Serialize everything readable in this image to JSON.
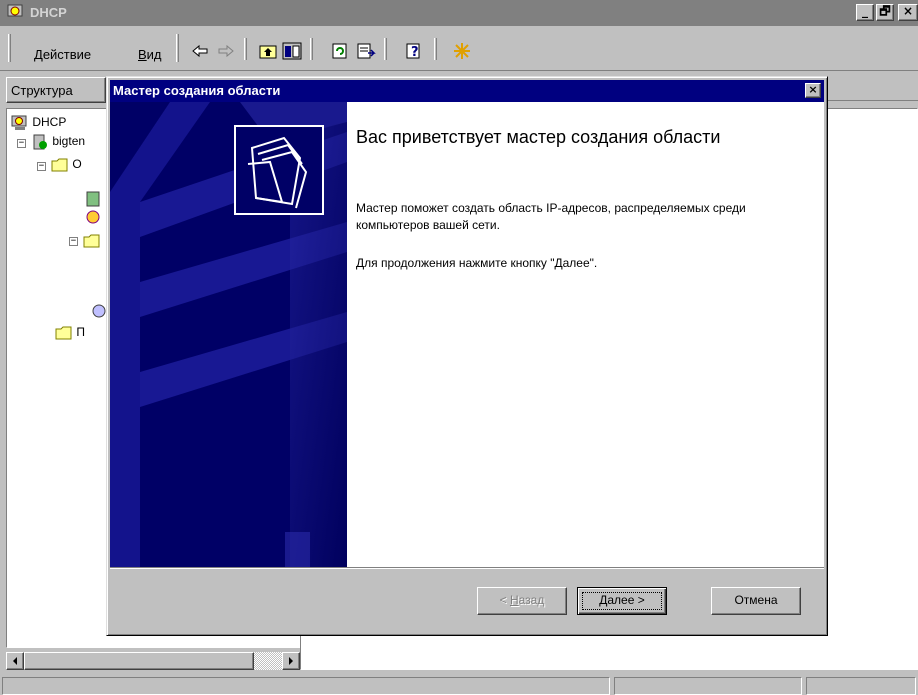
{
  "window": {
    "title": "DHCP",
    "minimize_label": "_",
    "maximize_label": "͐",
    "close_label": "×"
  },
  "menu": {
    "action_label_first": "Д",
    "action_label_rest": "ействие",
    "view_label_first": "В",
    "view_label_rest": "ид"
  },
  "toolbar": {
    "icons": [
      "back-arrow-icon",
      "forward-arrow-icon",
      "up-folder-icon",
      "show-hide-tree-icon",
      "refresh-icon",
      "export-list-icon",
      "help-icon",
      "new-scope-icon"
    ]
  },
  "tabs": {
    "structure_label": "Структура"
  },
  "tree": {
    "root_label": "DHCP",
    "server_label": "bigten",
    "child1_label": "О",
    "child2_label": "П"
  },
  "wizard": {
    "title": "Мастер создания области",
    "close_label": "×",
    "heading": "Вас приветствует мастер создания области",
    "description": "Мастер поможет создать область IP-адресов, распределяемых среди компьютеров вашей сети.",
    "continue_hint": "Для продолжения нажмите кнопку \"Далее\".",
    "back_label_prefix": "< ",
    "back_label_first": "Н",
    "back_label_rest": "азад",
    "next_label": "Далее >",
    "cancel_label": "Отмена"
  },
  "colors": {
    "titlebar_inactive": "#808080",
    "dialog_titlebar": "#000080",
    "wizard_banner": "#000066",
    "face": "#c0c0c0"
  }
}
